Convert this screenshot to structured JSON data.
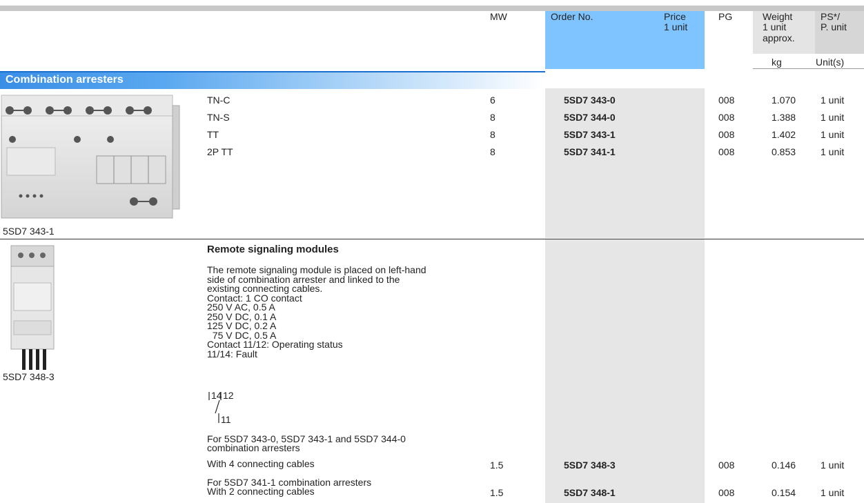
{
  "header": {
    "mw": "MW",
    "order_no": "Order No.",
    "price_line1": "Price",
    "price_line2": "1 unit",
    "pg": "PG",
    "weight_line1": "Weight",
    "weight_line2": "1 unit",
    "weight_line3": "approx.",
    "weight_unit": "kg",
    "ps_line1": "PS*/",
    "ps_line2": "P. unit",
    "ps_unit": "Unit(s)"
  },
  "section1": {
    "title": "Combination arresters",
    "image_caption": "5SD7 343-1",
    "rows": [
      {
        "type": "TN-C",
        "mw": "6",
        "order": "5SD7 343-0",
        "pg": "008",
        "weight": "1.070",
        "ps": "1 unit"
      },
      {
        "type": "TN-S",
        "mw": "8",
        "order": "5SD7 344-0",
        "pg": "008",
        "weight": "1.388",
        "ps": "1 unit"
      },
      {
        "type": "TT",
        "mw": "8",
        "order": "5SD7 343-1",
        "pg": "008",
        "weight": "1.402",
        "ps": "1 unit"
      },
      {
        "type": "2P TT",
        "mw": "8",
        "order": "5SD7 341-1",
        "pg": "008",
        "weight": "0.853",
        "ps": "1 unit"
      }
    ]
  },
  "section2": {
    "title": "Remote signaling modules",
    "image_caption": "5SD7 348-3",
    "description": "The remote signaling module is placed on left-hand\nside of combination arrester and linked to the\nexisting connecting cables.\nContact: 1 CO contact\n250 V AC, 0.5 A\n250 V DC, 0.1 A\n125 V DC, 0.2 A\n  75 V DC, 0.5 A\nContact 11/12: Operating status\n11/14: Fault",
    "contact_labels": {
      "a": "14",
      "b": "12",
      "c": "11"
    },
    "items": [
      {
        "line1": "For 5SD7 343-0, 5SD7 343-1 and 5SD7 344-0",
        "line2": "combination arresters",
        "line3": "With 4 connecting cables",
        "mw": "1.5",
        "order": "5SD7 348-3",
        "pg": "008",
        "weight": "0.146",
        "ps": "1 unit"
      },
      {
        "line1": "For 5SD7 341-1 combination arresters",
        "line2": "With 2 connecting cables",
        "mw": "1.5",
        "order": "5SD7 348-1",
        "pg": "008",
        "weight": "0.154",
        "ps": "1 unit"
      }
    ]
  }
}
